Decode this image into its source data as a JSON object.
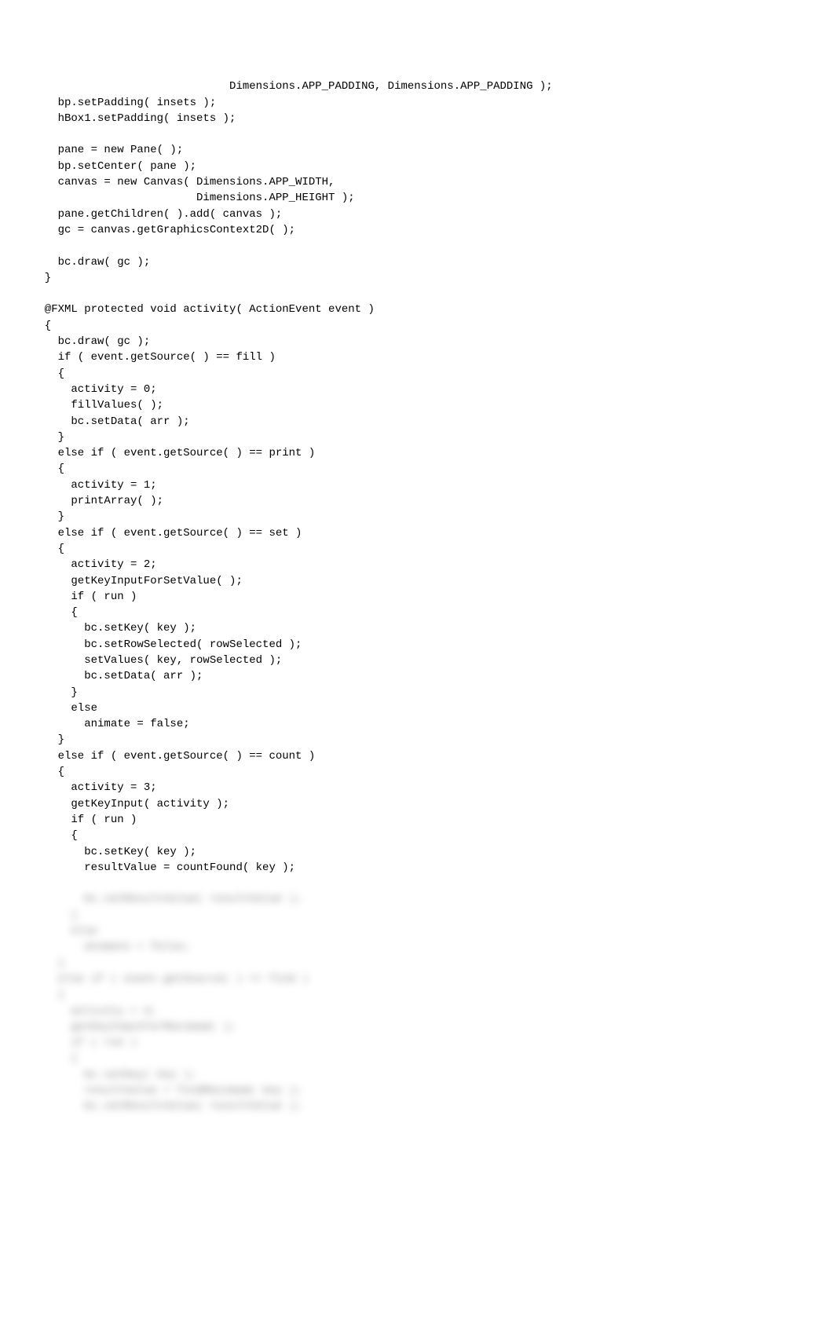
{
  "code": {
    "lines": [
      "                              Dimensions.APP_PADDING, Dimensions.APP_PADDING );",
      "    bp.setPadding( insets );",
      "    hBox1.setPadding( insets );",
      "",
      "    pane = new Pane( );",
      "    bp.setCenter( pane );",
      "    canvas = new Canvas( Dimensions.APP_WIDTH,",
      "                         Dimensions.APP_HEIGHT );",
      "    pane.getChildren( ).add( canvas );",
      "    gc = canvas.getGraphicsContext2D( );",
      "",
      "    bc.draw( gc );",
      "  }",
      "",
      "  @FXML protected void activity( ActionEvent event )",
      "  {",
      "    bc.draw( gc );",
      "    if ( event.getSource( ) == fill )",
      "    {",
      "      activity = 0;",
      "      fillValues( );",
      "      bc.setData( arr );",
      "    }",
      "    else if ( event.getSource( ) == print )",
      "    {",
      "      activity = 1;",
      "      printArray( );",
      "    }",
      "    else if ( event.getSource( ) == set )",
      "    {",
      "      activity = 2;",
      "      getKeyInputForSetValue( );",
      "      if ( run )",
      "      {",
      "        bc.setKey( key );",
      "        bc.setRowSelected( rowSelected );",
      "        setValues( key, rowSelected );",
      "        bc.setData( arr );",
      "      }",
      "      else",
      "        animate = false;",
      "    }",
      "    else if ( event.getSource( ) == count )",
      "    {",
      "      activity = 3;",
      "      getKeyInput( activity );",
      "      if ( run )",
      "      {",
      "        bc.setKey( key );",
      "        resultValue = countFound( key );"
    ],
    "blurred_lines": [
      "        bc.setResultValue( resultValue );",
      "      }",
      "      else",
      "        animate = false;",
      "    }",
      "    else if ( event.getSource( ) == find )",
      "    {",
      "      activity = 4;",
      "      getKeyInputForMaximum( );",
      "      if ( run )",
      "      {",
      "        bc.setKey( key );",
      "        resultValue = findMaximum( key );",
      "        bc.setResultValue( resultValue );"
    ]
  }
}
